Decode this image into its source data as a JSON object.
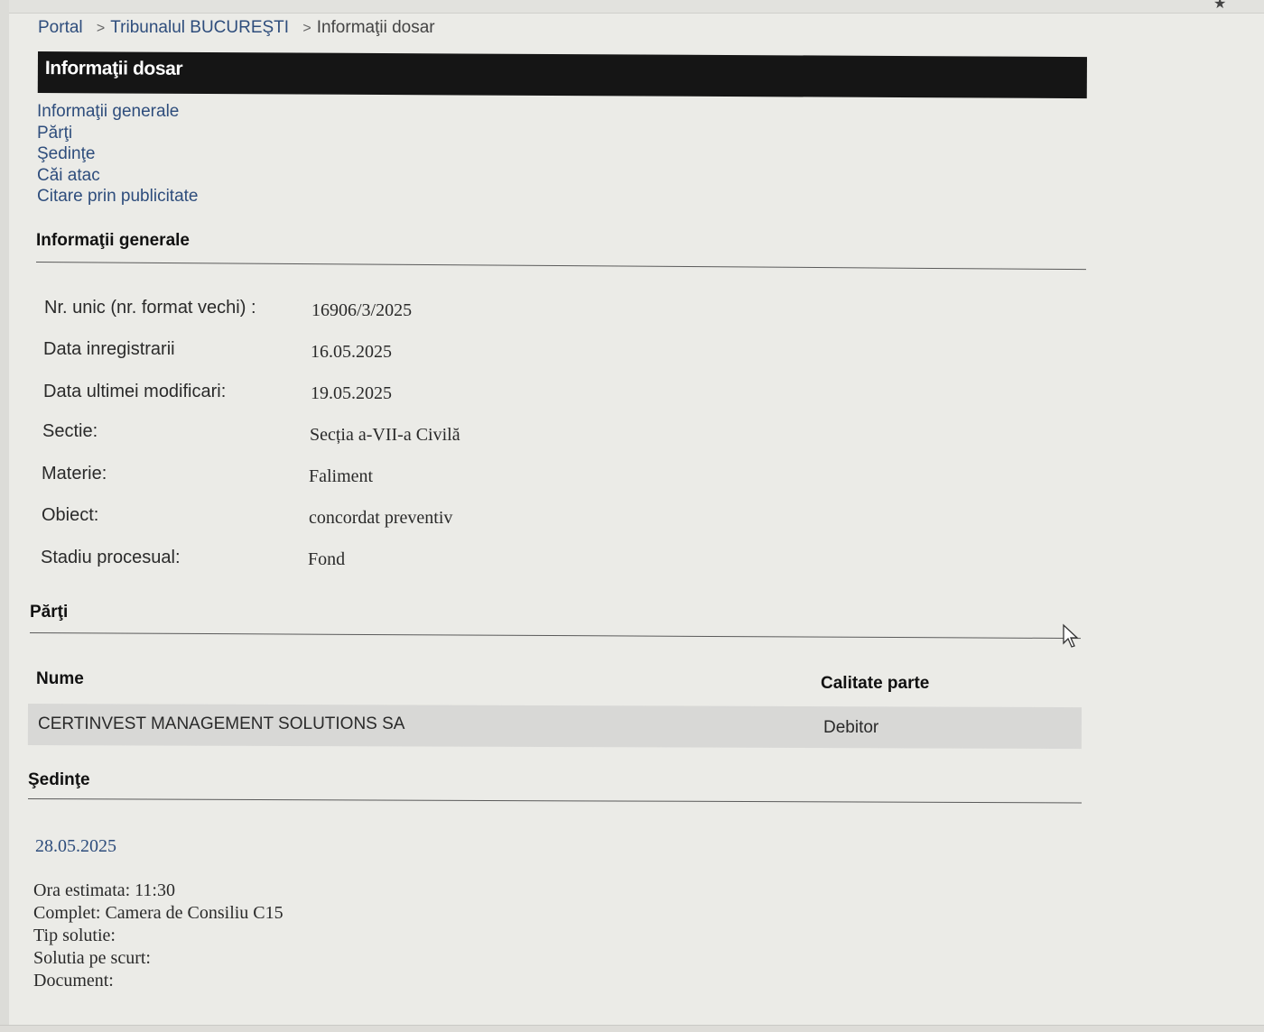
{
  "breadcrumb": {
    "items": [
      "Portal",
      "Tribunalul BUCUREŞTI"
    ],
    "current": "Informaţii dosar",
    "separator": ">"
  },
  "page_title": "Informaţii dosar",
  "nav_links": [
    "Informaţii generale",
    "Părţi",
    "Şedinţe",
    "Căi atac",
    "Citare prin publicitate"
  ],
  "general": {
    "heading": "Informaţii generale",
    "rows": [
      {
        "label": "Nr. unic (nr. format vechi) :",
        "value": "16906/3/2025"
      },
      {
        "label": "Data inregistrarii",
        "value": "16.05.2025"
      },
      {
        "label": "Data ultimei modificari:",
        "value": "19.05.2025"
      },
      {
        "label": "Sectie:",
        "value": "Secția a-VII-a Civilă"
      },
      {
        "label": "Materie:",
        "value": "Faliment"
      },
      {
        "label": "Obiect:",
        "value": "concordat preventiv"
      },
      {
        "label": "Stadiu procesual:",
        "value": "Fond"
      }
    ]
  },
  "parties": {
    "heading": "Părţi",
    "columns": {
      "name": "Nume",
      "role": "Calitate parte"
    },
    "rows": [
      {
        "name": "CERTINVEST MANAGEMENT SOLUTIONS SA",
        "role": "Debitor"
      }
    ]
  },
  "hearings": {
    "heading": "Şedinţe",
    "date": "28.05.2025",
    "lines": [
      "Ora estimata: 11:30",
      "Complet: Camera de Consiliu C15",
      "Tip solutie:",
      "Solutia pe scurt:",
      "Document:"
    ]
  },
  "icons": {
    "corner": "bookmark-icon",
    "cursor": "mouse-pointer-icon"
  },
  "colors": {
    "link": "#2e4d7c",
    "title_bar": "#151515",
    "background": "#ebebe7",
    "row_highlight": "#d8d8d6"
  }
}
